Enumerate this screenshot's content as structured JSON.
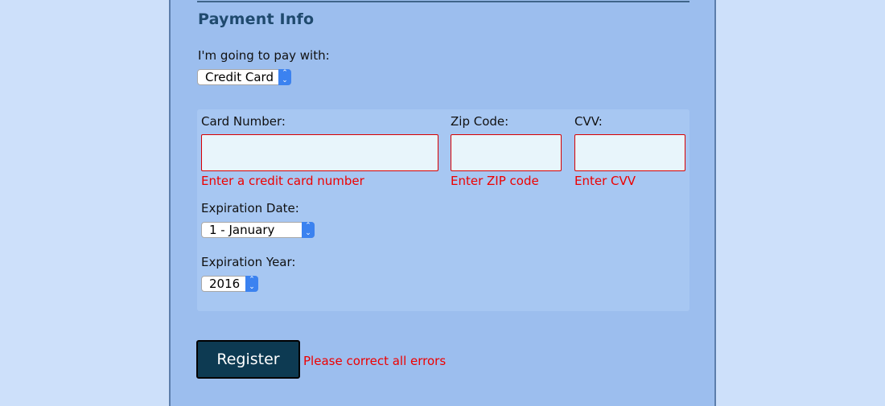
{
  "section": {
    "title": "Payment Info"
  },
  "payment": {
    "method_label": "I'm going to pay with:",
    "method_value": "Credit Card"
  },
  "card": {
    "number_label": "Card Number:",
    "number_value": "",
    "number_error": "Enter a credit card number",
    "zip_label": "Zip Code:",
    "zip_value": "",
    "zip_error": "Enter ZIP code",
    "cvv_label": "CVV:",
    "cvv_value": "",
    "cvv_error": "Enter CVV",
    "exp_date_label": "Expiration Date:",
    "exp_date_value": "1 - January",
    "exp_year_label": "Expiration Year:",
    "exp_year_value": "2016"
  },
  "form": {
    "submit_label": "Register",
    "error_message": "Please correct all errors"
  },
  "colors": {
    "page_background": "#cde0fa",
    "form_background": "#9cbeee",
    "card_panel_background": "#a7c7f2",
    "title": "#1f4a6e",
    "error": "#ee0000",
    "input_background": "#e8f5fb",
    "button_background": "#0d3a52",
    "select_arrow": "#3b82f0"
  }
}
